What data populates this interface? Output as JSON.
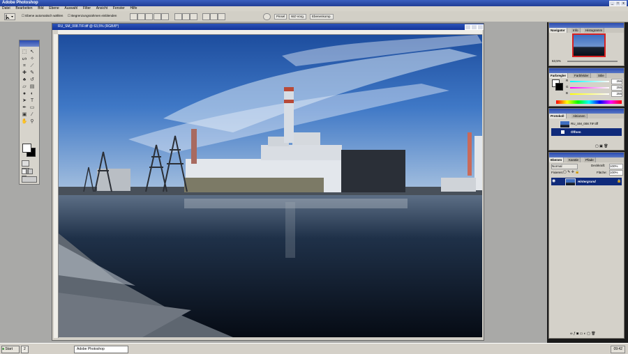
{
  "app": {
    "title": "Adobe Photoshop",
    "window_controls": [
      "_",
      "□",
      "x"
    ]
  },
  "menu": [
    "Datei",
    "Bearbeiten",
    "Bild",
    "Ebene",
    "Auswahl",
    "Filter",
    "Ansicht",
    "Fenster",
    "Hilfe"
  ],
  "options_bar": {
    "auto_select_label": "Ebene automatisch wählen",
    "bounding_box_label": "Begrenzungsrahmen einblenden",
    "palette_tabs": [
      "Pinsel",
      "WZ-Vorg.",
      "Ebenenkomp."
    ]
  },
  "document": {
    "title": "RU_SM_008.TIF.tiff @ 63,5% (RGB/8*)",
    "colors": {
      "sky": "#3a6fbf",
      "water": "#101c2c",
      "building": "#dfe3e8"
    }
  },
  "navigator": {
    "tabs": [
      "Navigator",
      "Info",
      "Histogramm"
    ],
    "zoom": "63,5%"
  },
  "color": {
    "tabs": [
      "Farbregler",
      "Farbfelder",
      "Stile"
    ],
    "channels": [
      {
        "label": "R",
        "value": "255"
      },
      {
        "label": "G",
        "value": "255"
      },
      {
        "label": "B",
        "value": "255"
      }
    ]
  },
  "history": {
    "tabs": [
      "Protokoll",
      "Aktionen"
    ],
    "snapshot": "RU_SM_008.TIF.tiff",
    "step": "Öffnen"
  },
  "layers": {
    "tabs": [
      "Ebenen",
      "Kanäle",
      "Pfade"
    ],
    "blend_mode": "Normal",
    "opacity_label": "Deckkraft:",
    "opacity_value": "100%",
    "lock_label": "Fixieren:",
    "fill_label": "Fläche:",
    "fill_value": "100%",
    "layer_name": "Hintergrund"
  },
  "taskbar": {
    "start": "Start",
    "quicklaunch": "2",
    "task": "Adobe Photoshop",
    "time": "09:42"
  }
}
